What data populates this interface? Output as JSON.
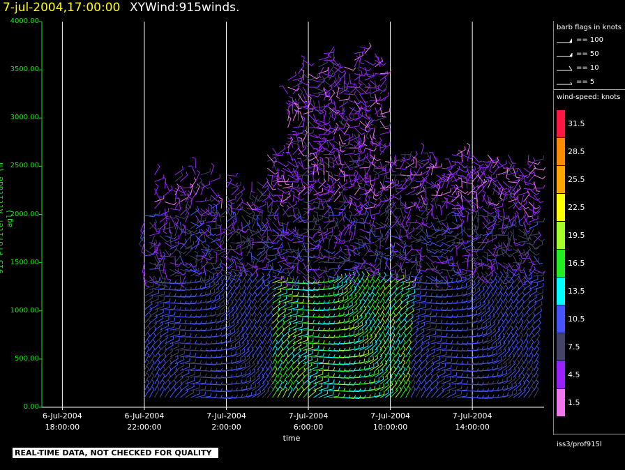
{
  "header": {
    "datetime": "7-jul-2004,17:00:00",
    "product": "XYWind:915winds."
  },
  "chart_data": {
    "type": "scatter",
    "subtype": "wind-barb time-height plot",
    "ylabel": "915 Profiler Altitude (m agl)",
    "xlabel": "time",
    "ylim": [
      0,
      4000
    ],
    "ytick_labels": [
      "0.00",
      "500.00",
      "1000.00",
      "1500.00",
      "2000.00",
      "2500.00",
      "3000.00",
      "3500.00",
      "4000.00"
    ],
    "ytick_values": [
      0,
      500,
      1000,
      1500,
      2000,
      2500,
      3000,
      3500,
      4000
    ],
    "xtick_labels": [
      {
        "date": "6-Jul-2004",
        "time": "18:00:00"
      },
      {
        "date": "6-Jul-2004",
        "time": "22:00:00"
      },
      {
        "date": "7-Jul-2004",
        "time": "2:00:00"
      },
      {
        "date": "7-Jul-2004",
        "time": "6:00:00"
      },
      {
        "date": "7-Jul-2004",
        "time": "10:00:00"
      },
      {
        "date": "7-Jul-2004",
        "time": "14:00:00"
      }
    ],
    "xtick_hours": [
      0,
      4,
      8,
      12,
      16,
      20
    ],
    "xlim_hours": [
      -1,
      23.5
    ],
    "grid": "vertical lines at x ticks",
    "data_start_hour": 4,
    "data_end_hour": 23,
    "profiles_per_hour": 4,
    "colors": {
      "background": "#000000",
      "axis": "#22dd22",
      "grid": "#ffffff",
      "title_date": "#ffff00"
    }
  },
  "legend": {
    "barb_title": "barb flags in knots",
    "flags": [
      {
        "symbol": "pennant",
        "label": "== 100"
      },
      {
        "symbol": "flag",
        "label": "== 50"
      },
      {
        "symbol": "full-barb",
        "label": "== 10"
      },
      {
        "symbol": "half-barb",
        "label": "== 5"
      }
    ],
    "speed_title": "wind-speed: knots",
    "colorbar": [
      {
        "label": "31.5",
        "color": "#ff1744"
      },
      {
        "label": "28.5",
        "color": "#ff8c00"
      },
      {
        "label": "25.5",
        "color": "#ffa500"
      },
      {
        "label": "22.5",
        "color": "#ffff00"
      },
      {
        "label": "19.5",
        "color": "#a5ff2a"
      },
      {
        "label": "16.5",
        "color": "#22ee22"
      },
      {
        "label": "13.5",
        "color": "#00ffff"
      },
      {
        "label": "10.5",
        "color": "#4455ff"
      },
      {
        "label": "7.5",
        "color": "#44446a"
      },
      {
        "label": "4.5",
        "color": "#9922ff"
      },
      {
        "label": "1.5",
        "color": "#ee77ee"
      }
    ],
    "station": "iss3/prof915l"
  },
  "footer": {
    "disclaimer": "REAL-TIME DATA, NOT CHECKED FOR QUALITY"
  }
}
